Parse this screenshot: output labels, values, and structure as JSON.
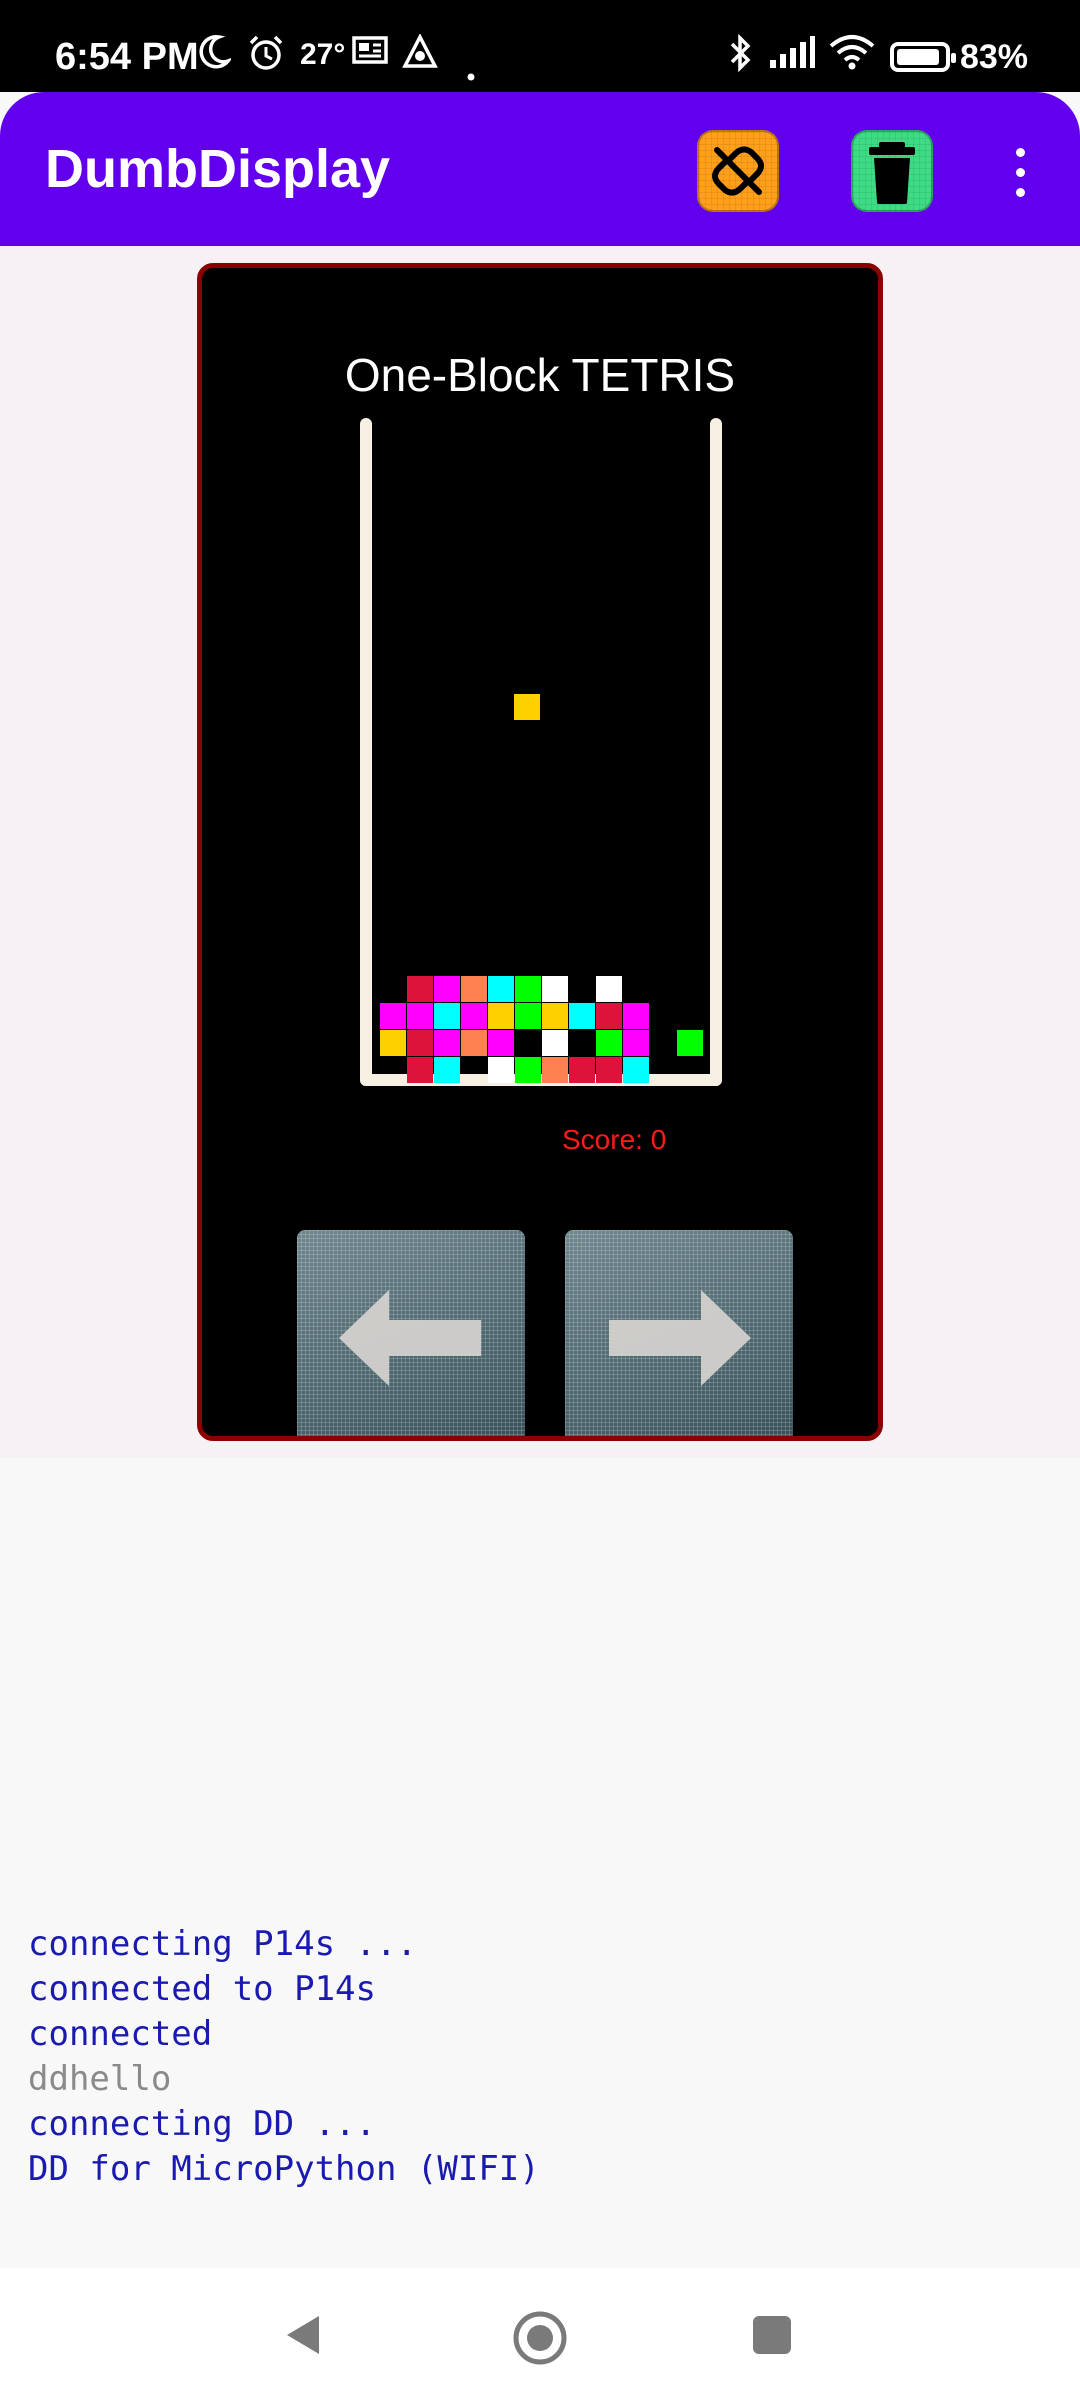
{
  "status_bar": {
    "time": "6:54 PM",
    "temperature": "27°",
    "battery_percent": "83%",
    "icons": [
      "moon-icon",
      "alarm-icon",
      "news-icon",
      "app-icon",
      "dot-icon",
      "bluetooth-icon",
      "signal-icon",
      "wifi-icon",
      "battery-icon"
    ]
  },
  "app_bar": {
    "title": "DumbDisplay",
    "actions": [
      {
        "name": "disconnect-icon",
        "color": "#ff9f1a"
      },
      {
        "name": "trash-icon",
        "color": "#3ddc84"
      },
      {
        "name": "more-vert-icon"
      }
    ],
    "color": "#6200ee"
  },
  "game": {
    "title": "One-Block TETRIS",
    "score_label": "Score: 0",
    "falling_block": {
      "color": "#ffd000"
    },
    "controls": [
      {
        "name": "left-arrow-icon"
      },
      {
        "name": "right-arrow-icon"
      }
    ],
    "border_color": "#8b0000"
  },
  "log": [
    {
      "text": "connecting P14s ...",
      "style": "blue"
    },
    {
      "text": "connected to P14s",
      "style": "blue"
    },
    {
      "text": "connected",
      "style": "blue"
    },
    {
      "text": "ddhello",
      "style": "gray"
    },
    {
      "text": "connecting DD ...",
      "style": "blue"
    },
    {
      "text": "DD for MicroPython (WIFI)",
      "style": "blue"
    }
  ],
  "nav_bar": {
    "buttons": [
      "back-icon",
      "home-icon",
      "recents-icon"
    ]
  }
}
